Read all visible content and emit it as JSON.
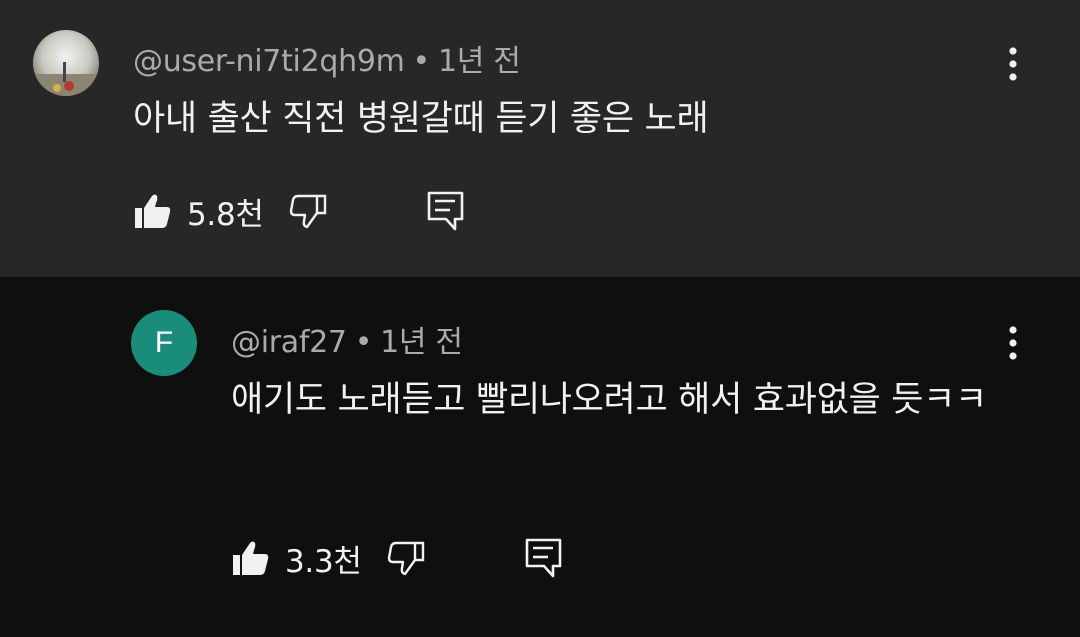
{
  "comments": [
    {
      "author": "@user-ni7ti2qh9m",
      "time": "1년 전",
      "text": "아내 출산 직전 병원갈때 듣기 좋은 노래",
      "likes": "5.8천"
    }
  ],
  "reply": {
    "avatar_letter": "F",
    "author": "@iraf27",
    "time": "1년 전",
    "text": "애기도 노래듣고 빨리나오려고 해서 효과없을 듯ㅋㅋ",
    "likes": "3.3천"
  },
  "colors": {
    "parent_bg": "#272727",
    "reply_bg": "#0f0f0f",
    "reply_avatar": "#1a8d7a",
    "meta_text": "#aaaaaa"
  }
}
